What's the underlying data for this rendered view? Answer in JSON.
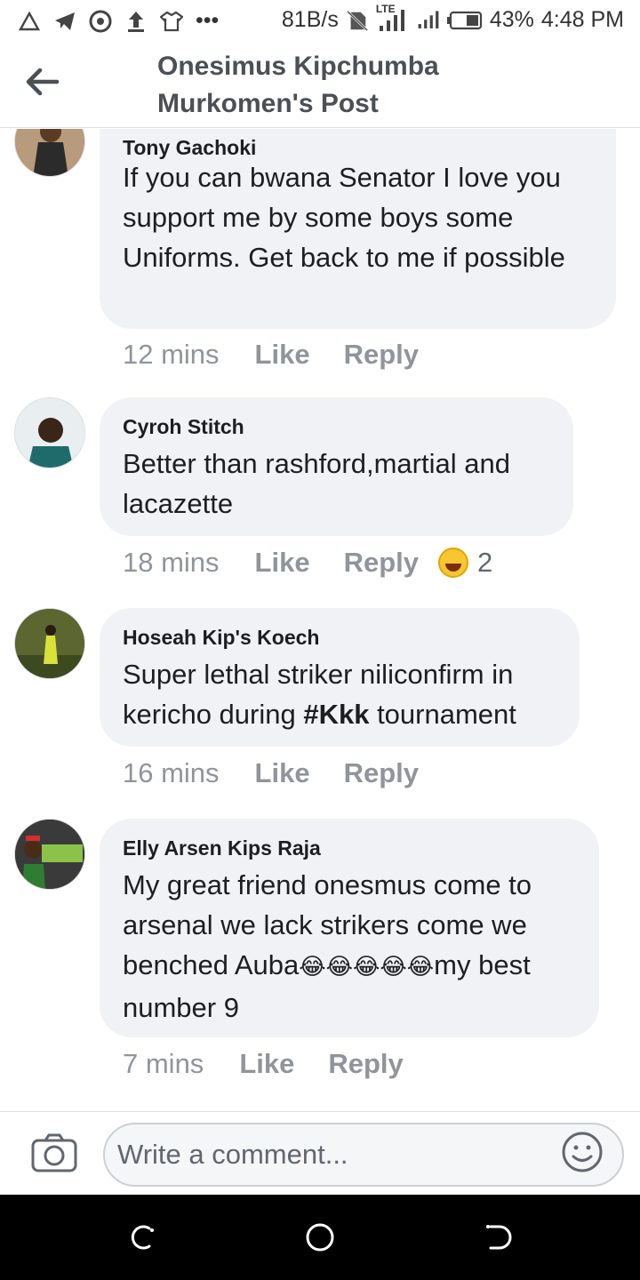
{
  "status_bar": {
    "net_speed": "81B/s",
    "lte": "LTE",
    "battery_percent": "43%",
    "time": "4:48 PM",
    "dots": "•••",
    "left_icons": [
      "alert-icon",
      "telegram-icon",
      "app-icon",
      "upload-icon",
      "shirt-icon"
    ]
  },
  "header": {
    "title_line1": "Onesimus Kipchumba",
    "title_line2": "Murkomen's Post"
  },
  "comments": [
    {
      "author": "Tony Gachoki",
      "text": "If you can bwana Senator I love you support me by some boys some Uniforms. Get back to me if possible",
      "time": "12 mins",
      "like": "Like",
      "reply": "Reply"
    },
    {
      "author": "Cyroh Stitch",
      "text": "Better than rashford,martial and lacazette",
      "time": "18 mins",
      "like": "Like",
      "reply": "Reply",
      "reaction_count": "2",
      "reaction_icon": "laughing-emoji-icon"
    },
    {
      "author": "Hoseah Kip's Koech",
      "text_before": "Super lethal striker niliconfirm in kericho during ",
      "hashtag": "#Kkk",
      "text_after": " tournament",
      "time": "16 mins",
      "like": "Like",
      "reply": "Reply"
    },
    {
      "author": "Elly Arsen Kips Raja",
      "text_before": "My great friend onesmus come to arsenal we lack strikers come we benched Auba",
      "emoji": "😂😂😂😂😂",
      "text_after": "my best number 9",
      "time": "7 mins",
      "like": "Like",
      "reply": "Reply"
    }
  ],
  "composer": {
    "placeholder": "Write a comment..."
  },
  "colors": {
    "bubble": "#f0f2f5",
    "meta_text": "#90949c",
    "header_text": "#4b4f56",
    "navbar": "#000000"
  }
}
